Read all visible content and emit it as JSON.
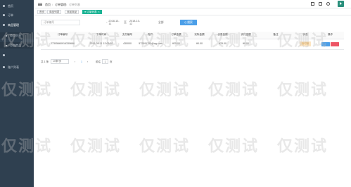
{
  "sidebar": {
    "items": [
      {
        "label": "首页",
        "sub": false
      },
      {
        "label": "订单",
        "sub": false
      },
      {
        "label": "商品管理",
        "sub": false
      },
      {
        "label": "商品列表",
        "sub": true
      },
      {
        "label": "添加商品",
        "sub": true
      },
      {
        "label": "",
        "sub": false
      },
      {
        "label": "账户列表",
        "sub": false
      }
    ]
  },
  "topbar": {
    "breadcrumb": [
      "首页",
      "订单管理",
      "订单列表"
    ]
  },
  "tabs": [
    {
      "label": "首页",
      "active": false
    },
    {
      "label": "商品列表",
      "active": false
    },
    {
      "label": "添加商品",
      "active": false
    },
    {
      "label": "● 订单列表",
      "active": true
    }
  ],
  "filters": {
    "order_no_placeholder": "订单编号",
    "date_start": "2018-10-11",
    "date_end": "2018-10-12",
    "date_sep": "至",
    "status": "全部",
    "search_label": "Q 搜索"
  },
  "table": {
    "headers": [
      "订单编号",
      "下单时间",
      "支付编号",
      "账户",
      "订单金额",
      "实际金额",
      "优惠金额",
      "实付金额",
      "备注",
      "状态",
      "操作"
    ],
    "rows": [
      {
        "order_no": "27305660916330666",
        "time": "2015-09-11 12:06:52",
        "pay_no": "430000",
        "account": "572591750@qq.com",
        "amount": "¥25.00",
        "actual": "¥0.00",
        "discount": "¥25.00",
        "paid": "¥0.00",
        "note": "",
        "status": "待付款",
        "action_edit": "",
        "action_delete": ""
      }
    ]
  },
  "pagination": {
    "summary": "共 1 条",
    "per_page": "10条/页",
    "page": "1",
    "goto_label": "前往",
    "goto_value": "1",
    "page_suffix": "页"
  },
  "watermark": "仅测试",
  "colors": {
    "sidebar": "#2f4050",
    "accent": "#1ab394",
    "primary_button": "#4c9fe8",
    "danger": "#ed5565",
    "pending_badge": "#fde5c2"
  }
}
